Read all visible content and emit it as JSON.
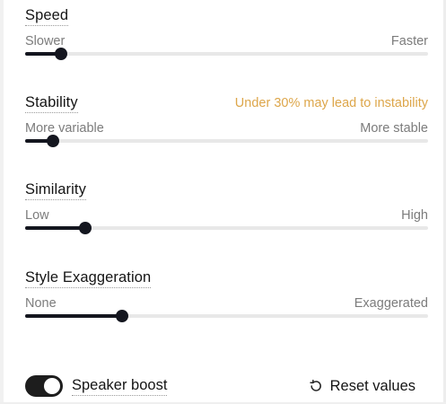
{
  "settings": [
    {
      "id": "speed",
      "title": "Speed",
      "warning": "",
      "min_label": "Slower",
      "max_label": "Faster",
      "value": 0.09
    },
    {
      "id": "stability",
      "title": "Stability",
      "warning": "Under 30% may lead to instability",
      "min_label": "More variable",
      "max_label": "More stable",
      "value": 0.07
    },
    {
      "id": "similarity",
      "title": "Similarity",
      "warning": "",
      "min_label": "Low",
      "max_label": "High",
      "value": 0.15
    },
    {
      "id": "style",
      "title": "Style Exaggeration",
      "warning": "",
      "min_label": "None",
      "max_label": "Exaggerated",
      "value": 0.24
    }
  ],
  "footer": {
    "speaker_boost_label": "Speaker boost",
    "speaker_boost_on": true,
    "reset_label": "Reset values",
    "reset_icon": "reset-icon"
  },
  "colors": {
    "slider_active": "#14161f",
    "slider_track": "#e8e8e8",
    "warning": "#dda64a"
  }
}
